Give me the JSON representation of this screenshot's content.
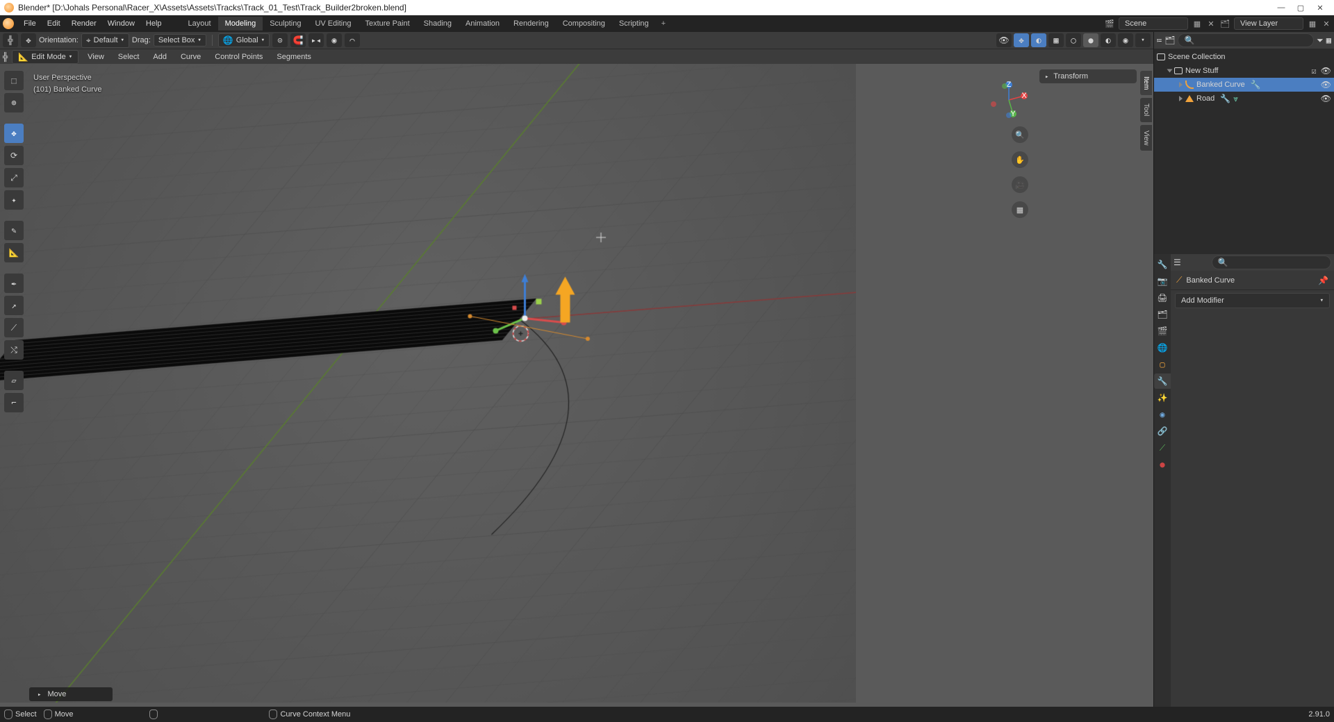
{
  "title": "Blender* [D:\\Johals Personal\\Racer_X\\Assets\\Assets\\Tracks\\Track_01_Test\\Track_Builder2broken.blend]",
  "menu": [
    "File",
    "Edit",
    "Render",
    "Window",
    "Help"
  ],
  "workspaces": [
    "Layout",
    "Modeling",
    "Sculpting",
    "UV Editing",
    "Texture Paint",
    "Shading",
    "Animation",
    "Rendering",
    "Compositing",
    "Scripting"
  ],
  "active_workspace": "Modeling",
  "scene_field": "Scene",
  "layer_field": "View Layer",
  "header": {
    "orientation_label": "Orientation:",
    "orientation_value": "Default",
    "drag_label": "Drag:",
    "drag_value": "Select Box",
    "transform_space": "Global"
  },
  "edit_header": {
    "mode": "Edit Mode",
    "menus": [
      "View",
      "Select",
      "Add",
      "Curve",
      "Control Points",
      "Segments"
    ]
  },
  "viewport": {
    "perspective": "User Perspective",
    "object_info": "(101) Banked Curve",
    "last_operator": "Move",
    "right_tabs": [
      "Item",
      "Tool",
      "View"
    ],
    "npanel_header": "Transform"
  },
  "outliner": {
    "root": "Scene Collection",
    "collection": "New Stuff",
    "items": [
      {
        "name": "Banked Curve",
        "type": "curve",
        "selected": true
      },
      {
        "name": "Road",
        "type": "mesh",
        "selected": false
      }
    ]
  },
  "properties": {
    "object_name": "Banked Curve",
    "add_modifier": "Add Modifier"
  },
  "footer": {
    "select": "Select",
    "move": "Move",
    "context_menu": "Curve Context Menu",
    "version": "2.91.0"
  }
}
